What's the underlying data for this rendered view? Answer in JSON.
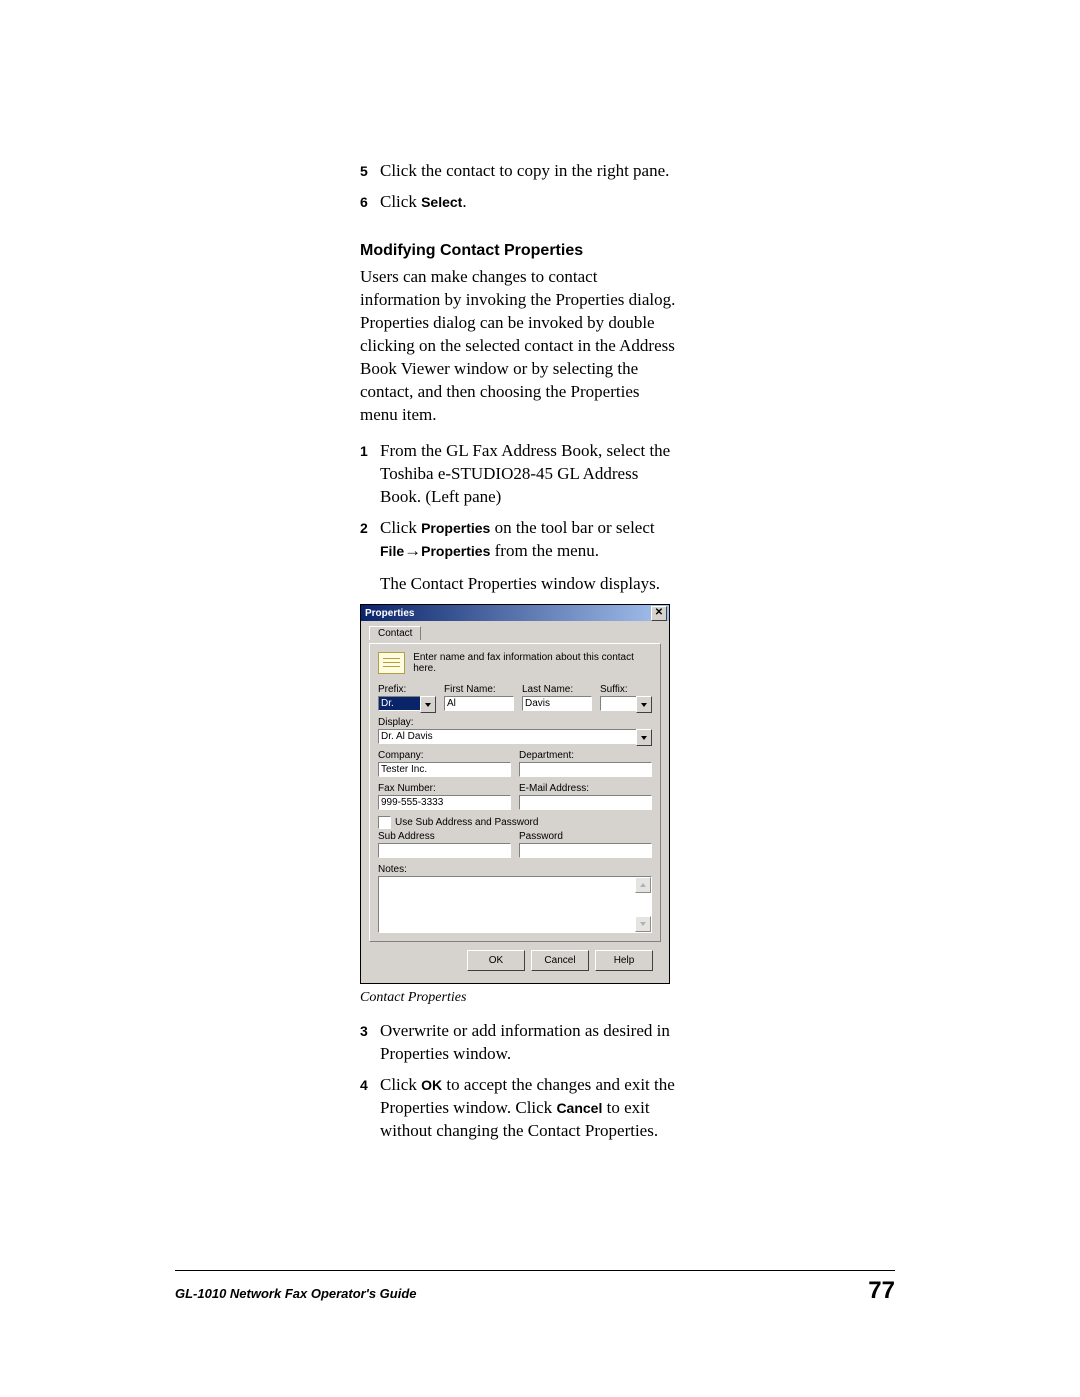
{
  "steps_top": [
    {
      "n": "5",
      "body": "Click the contact to copy in the right pane."
    },
    {
      "n": "6",
      "pre": "Click ",
      "ui": "Select",
      "post": "."
    }
  ],
  "section_heading": "Modifying Contact Properties",
  "intro": "Users can make changes to contact information by invoking the Properties dialog. Properties dialog can be invoked by double clicking on the selected contact in the Address Book Viewer window or by selecting the contact, and then choosing the Properties menu item.",
  "steps_mid": [
    {
      "n": "1",
      "body": "From the GL Fax Address Book, select the Toshiba e-STUDIO28-45 GL Address Book. (Left pane)"
    },
    {
      "n": "2",
      "pre": "Click ",
      "ui1": "Properties",
      "mid": " on the tool bar or select ",
      "ui2": "File",
      "arrow": "→",
      "ui3": "Properties",
      "post": " from the menu.",
      "extra": "The Contact Properties window displays."
    }
  ],
  "dialog": {
    "title": "Properties",
    "tab": "Contact",
    "hint": "Enter name and fax information about this contact here.",
    "labels": {
      "prefix": "Prefix:",
      "first": "First Name:",
      "last": "Last Name:",
      "suffix": "Suffix:",
      "display": "Display:",
      "company": "Company:",
      "department": "Department:",
      "fax": "Fax Number:",
      "email": "E-Mail Address:",
      "usesub": "Use Sub Address and Password",
      "sub": "Sub Address",
      "pwd": "Password",
      "notes": "Notes:"
    },
    "values": {
      "prefix": "Dr.",
      "first": "Al",
      "last": "Davis",
      "suffix": "",
      "display": "Dr. Al Davis",
      "company": "Tester Inc.",
      "department": "",
      "fax": "999-555-3333",
      "email": "",
      "sub": "",
      "pwd": "",
      "notes": ""
    },
    "buttons": {
      "ok": "OK",
      "cancel": "Cancel",
      "help": "Help"
    }
  },
  "caption": "Contact Properties",
  "steps_bottom": [
    {
      "n": "3",
      "body": "Overwrite or add information as desired in Properties window."
    },
    {
      "n": "4",
      "pre": "Click ",
      "ui1": "OK",
      "mid": " to accept the changes and exit the Properties window. Click ",
      "ui2": "Cancel",
      "post": " to exit without changing the Contact Properties."
    }
  ],
  "footer": {
    "title": "GL-1010 Network Fax Operator's Guide",
    "page": "77"
  }
}
